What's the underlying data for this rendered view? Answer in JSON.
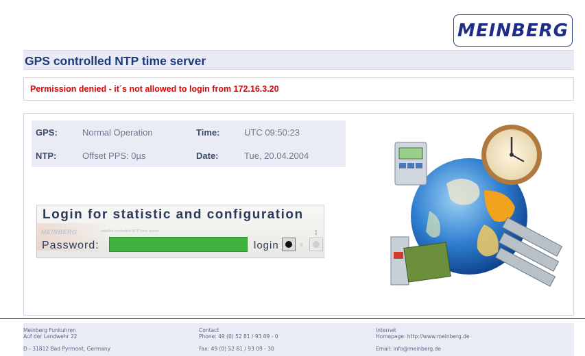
{
  "header": {
    "logo_text": "MEINBERG",
    "title": "GPS controlled NTP time server"
  },
  "error": {
    "message": "Permission denied - it´s not allowed to login from 172.16.3.20",
    "color": "#e00000"
  },
  "status": {
    "gps_label": "GPS:",
    "gps_value": "Normal Operation",
    "time_label": "Time:",
    "time_value": "UTC 09:50:23",
    "ntp_label": "NTP:",
    "ntp_value": "Offset PPS: 0µs",
    "date_label": "Date:",
    "date_value": "Tue, 20.04.2004"
  },
  "login": {
    "title": "Login for statistic and configuration",
    "password_label": "Password:",
    "password_value": "",
    "login_label": "login",
    "ghost_brand": "MEINBERG",
    "ghost_caption": "satellite controlled NTP time server",
    "input_color": "#3fb23f"
  },
  "footer": {
    "company": "Meinberg Funkuhren",
    "street": "Auf der Landwehr 22",
    "city": "D - 31812 Bad Pyrmont, Germany",
    "contact_heading": "Contact",
    "phone": "Phone: 49 (0) 52 81 / 93 09 - 0",
    "fax": "Fax: 49 (0) 52 81 / 93 09 - 30",
    "internet_heading": "Internet",
    "homepage": "Homepage: http://www.meinberg.de",
    "email": "Email: info@meinberg.de"
  },
  "colors": {
    "accent": "#1f3a78",
    "panel": "#e9ecf4",
    "footer_rule": "#2c3a8a"
  },
  "icons": [
    "meinberg-logo",
    "globe-clock-illustration",
    "login-button-icon"
  ]
}
